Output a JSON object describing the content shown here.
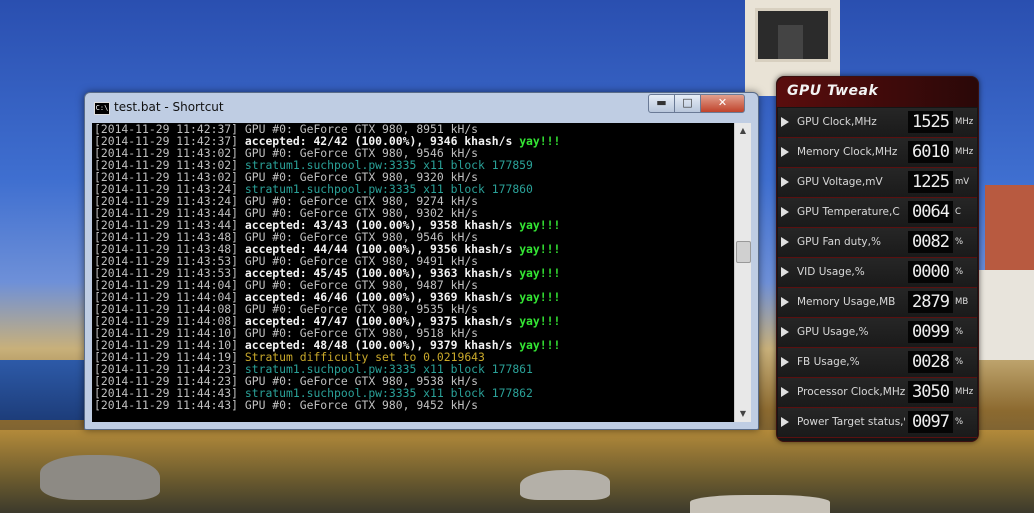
{
  "window": {
    "title": "test.bat - Shortcut",
    "icon": "console-icon",
    "icon_text": "C:\\",
    "buttons": {
      "minimize": "▬",
      "maximize": "□",
      "close": "✕"
    }
  },
  "console": {
    "lines": [
      [
        {
          "t": "[2014-11-29 11:42:37] ",
          "c": "gray"
        },
        {
          "t": "GPU #0: GeForce GTX 980, 8951 kH/s",
          "c": "gray"
        }
      ],
      [
        {
          "t": "[2014-11-29 11:42:37] ",
          "c": "gray"
        },
        {
          "t": "accepted: 42/42 (100.00%), 9346 khash/s ",
          "c": "white"
        },
        {
          "t": "yay!!!",
          "c": "green"
        }
      ],
      [
        {
          "t": "[2014-11-29 11:43:02] ",
          "c": "gray"
        },
        {
          "t": "GPU #0: GeForce GTX 980, 9546 kH/s",
          "c": "gray"
        }
      ],
      [
        {
          "t": "[2014-11-29 11:43:02] ",
          "c": "gray"
        },
        {
          "t": "stratum1.suchpool.pw:3335 x11 block 177859",
          "c": "teal"
        }
      ],
      [
        {
          "t": "[2014-11-29 11:43:02] ",
          "c": "gray"
        },
        {
          "t": "GPU #0: GeForce GTX 980, 9320 kH/s",
          "c": "gray"
        }
      ],
      [
        {
          "t": "[2014-11-29 11:43:24] ",
          "c": "gray"
        },
        {
          "t": "stratum1.suchpool.pw:3335 x11 block 177860",
          "c": "teal"
        }
      ],
      [
        {
          "t": "[2014-11-29 11:43:24] ",
          "c": "gray"
        },
        {
          "t": "GPU #0: GeForce GTX 980, 9274 kH/s",
          "c": "gray"
        }
      ],
      [
        {
          "t": "[2014-11-29 11:43:44] ",
          "c": "gray"
        },
        {
          "t": "GPU #0: GeForce GTX 980, 9302 kH/s",
          "c": "gray"
        }
      ],
      [
        {
          "t": "[2014-11-29 11:43:44] ",
          "c": "gray"
        },
        {
          "t": "accepted: 43/43 (100.00%), 9358 khash/s ",
          "c": "white"
        },
        {
          "t": "yay!!!",
          "c": "green"
        }
      ],
      [
        {
          "t": "[2014-11-29 11:43:48] ",
          "c": "gray"
        },
        {
          "t": "GPU #0: GeForce GTX 980, 9546 kH/s",
          "c": "gray"
        }
      ],
      [
        {
          "t": "[2014-11-29 11:43:48] ",
          "c": "gray"
        },
        {
          "t": "accepted: 44/44 (100.00%), 9356 khash/s ",
          "c": "white"
        },
        {
          "t": "yay!!!",
          "c": "green"
        }
      ],
      [
        {
          "t": "[2014-11-29 11:43:53] ",
          "c": "gray"
        },
        {
          "t": "GPU #0: GeForce GTX 980, 9491 kH/s",
          "c": "gray"
        }
      ],
      [
        {
          "t": "[2014-11-29 11:43:53] ",
          "c": "gray"
        },
        {
          "t": "accepted: 45/45 (100.00%), 9363 khash/s ",
          "c": "white"
        },
        {
          "t": "yay!!!",
          "c": "green"
        }
      ],
      [
        {
          "t": "[2014-11-29 11:44:04] ",
          "c": "gray"
        },
        {
          "t": "GPU #0: GeForce GTX 980, 9487 kH/s",
          "c": "gray"
        }
      ],
      [
        {
          "t": "[2014-11-29 11:44:04] ",
          "c": "gray"
        },
        {
          "t": "accepted: 46/46 (100.00%), 9369 khash/s ",
          "c": "white"
        },
        {
          "t": "yay!!!",
          "c": "green"
        }
      ],
      [
        {
          "t": "[2014-11-29 11:44:08] ",
          "c": "gray"
        },
        {
          "t": "GPU #0: GeForce GTX 980, 9535 kH/s",
          "c": "gray"
        }
      ],
      [
        {
          "t": "[2014-11-29 11:44:08] ",
          "c": "gray"
        },
        {
          "t": "accepted: 47/47 (100.00%), 9375 khash/s ",
          "c": "white"
        },
        {
          "t": "yay!!!",
          "c": "green"
        }
      ],
      [
        {
          "t": "[2014-11-29 11:44:10] ",
          "c": "gray"
        },
        {
          "t": "GPU #0: GeForce GTX 980, 9518 kH/s",
          "c": "gray"
        }
      ],
      [
        {
          "t": "[2014-11-29 11:44:10] ",
          "c": "gray"
        },
        {
          "t": "accepted: 48/48 (100.00%), 9379 khash/s ",
          "c": "white"
        },
        {
          "t": "yay!!!",
          "c": "green"
        }
      ],
      [
        {
          "t": "[2014-11-29 11:44:19] ",
          "c": "gray"
        },
        {
          "t": "Stratum difficulty set to 0.0219643",
          "c": "yellow"
        }
      ],
      [
        {
          "t": "[2014-11-29 11:44:23] ",
          "c": "gray"
        },
        {
          "t": "stratum1.suchpool.pw:3335 x11 block 177861",
          "c": "teal"
        }
      ],
      [
        {
          "t": "[2014-11-29 11:44:23] ",
          "c": "gray"
        },
        {
          "t": "GPU #0: GeForce GTX 980, 9538 kH/s",
          "c": "gray"
        }
      ],
      [
        {
          "t": "[2014-11-29 11:44:43] ",
          "c": "gray"
        },
        {
          "t": "stratum1.suchpool.pw:3335 x11 block 177862",
          "c": "teal"
        }
      ],
      [
        {
          "t": "[2014-11-29 11:44:43] ",
          "c": "gray"
        },
        {
          "t": "GPU #0: GeForce GTX 980, 9452 kH/s",
          "c": "gray"
        }
      ]
    ],
    "colors": {
      "gray": "#c0c0c0",
      "white": "#f2f2f2",
      "teal": "#2aa198",
      "yellow": "#c9a92b",
      "green": "#34e634"
    },
    "scroll": {
      "up": "▲",
      "down": "▼"
    }
  },
  "gpu_tweak": {
    "title": "GPU Tweak",
    "rows": [
      {
        "label": "GPU Clock,MHz",
        "value": "1525",
        "unit": "MHz"
      },
      {
        "label": "Memory Clock,MHz",
        "value": "6010",
        "unit": "MHz"
      },
      {
        "label": "GPU Voltage,mV",
        "value": "1225",
        "unit": "mV"
      },
      {
        "label": "GPU Temperature,C",
        "value": "0064",
        "unit": "C"
      },
      {
        "label": "GPU Fan duty,%",
        "value": "0082",
        "unit": "%"
      },
      {
        "label": "VID Usage,%",
        "value": "0000",
        "unit": "%"
      },
      {
        "label": "Memory Usage,MB",
        "value": "2879",
        "unit": "MB"
      },
      {
        "label": "GPU Usage,%",
        "value": "0099",
        "unit": "%"
      },
      {
        "label": "FB Usage,%",
        "value": "0028",
        "unit": "%"
      },
      {
        "label": "Processor Clock,MHz",
        "value": "3050",
        "unit": "MHz"
      },
      {
        "label": "Power Target status,%",
        "value": "0097",
        "unit": "%"
      }
    ]
  }
}
